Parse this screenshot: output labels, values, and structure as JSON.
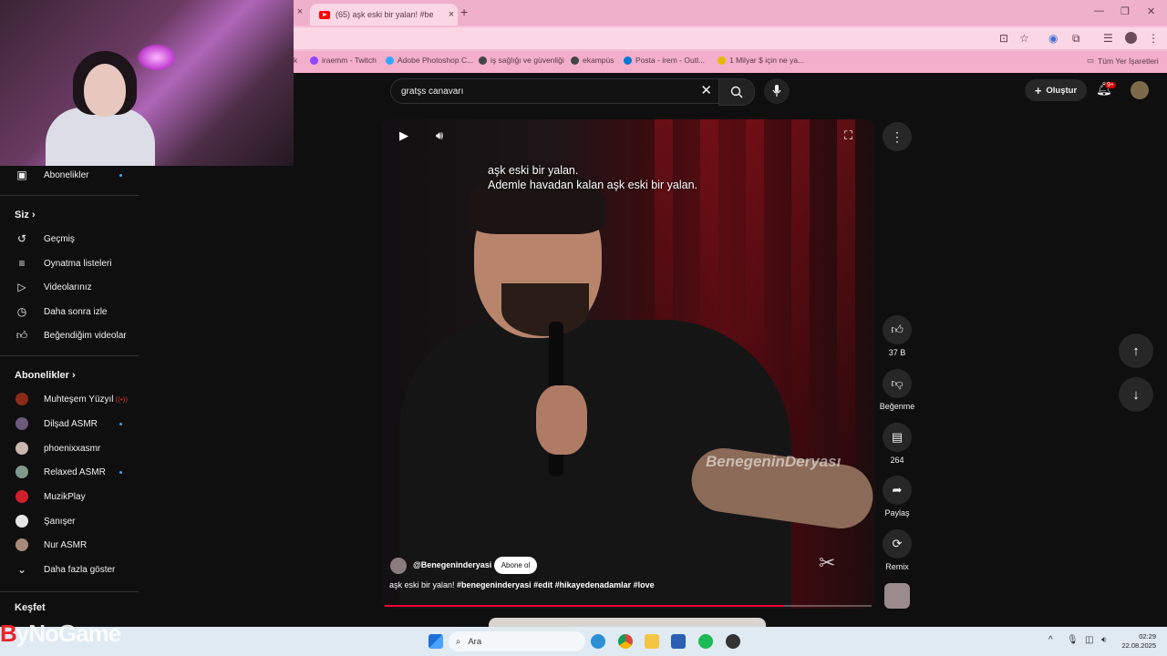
{
  "browser": {
    "tab_title": "(65) aşk eski bir yalan! #be",
    "bookmarks": [
      {
        "label": "iraemm - Twitch",
        "color": "#9146ff"
      },
      {
        "label": "Adobe Photoshop C...",
        "color": "#31a8ff"
      },
      {
        "label": "iş sağlığı ve güvenliği",
        "color": "#444444"
      },
      {
        "label": "ekampüs",
        "color": "#444444"
      },
      {
        "label": "Posta - irem - Outl...",
        "color": "#0078d4"
      },
      {
        "label": "1 Milyar $ için ne ya...",
        "color": "#e6b800"
      }
    ],
    "all_bookmarks": "Tüm Yer İşaretleri"
  },
  "header": {
    "search_value": "gratşs canavarı",
    "create_label": "Oluştur",
    "notif_badge": "9+"
  },
  "sidebar": {
    "top_item": "Abonelikler",
    "you_header": "Siz",
    "you_items": [
      {
        "label": "Geçmiş",
        "icon": "history-icon"
      },
      {
        "label": "Oynatma listeleri",
        "icon": "playlist-icon"
      },
      {
        "label": "Videolarınız",
        "icon": "video-icon"
      },
      {
        "label": "Daha sonra izle",
        "icon": "clock-icon"
      },
      {
        "label": "Beğendiğim videolar",
        "icon": "thumbs-up-icon"
      }
    ],
    "subs_header": "Abonelikler",
    "subs": [
      {
        "label": "Muhteşem Yüzyıl",
        "color": "#8a2a1a",
        "dot": false
      },
      {
        "label": "Dilşad ASMR",
        "color": "#6b5a7a",
        "dot": true
      },
      {
        "label": "phoenixxasmr",
        "color": "#c9b7b0",
        "dot": false
      },
      {
        "label": "Relaxed ASMR",
        "color": "#7f9a8a",
        "dot": true
      },
      {
        "label": "MuzikPlay",
        "color": "#d0202a",
        "dot": false
      },
      {
        "label": "Şanışer",
        "color": "#e6e6e6",
        "dot": false
      },
      {
        "label": "Nur ASMR",
        "color": "#a88a7a",
        "dot": false
      }
    ],
    "show_more": "Daha fazla göster",
    "explore": "Keşfet"
  },
  "video": {
    "subtitle_line1": "aşk eski bir yalan.",
    "subtitle_line2": "Ademle havadan kalan aşk eski bir yalan.",
    "watermark": "BenegeninDeryası",
    "channel": "@Benegeninderyasi",
    "subscribe_label": "Abone ol",
    "title_plain": "aşk eski bir yalan!",
    "title_tags": "#benegeninderyasi #edit #hikayedenadamlar #love",
    "progress": 0.82
  },
  "actions": {
    "like_count": "37 B",
    "dislike_label": "Beğenme",
    "comment_count": "264",
    "share_label": "Paylaş",
    "remix_label": "Remix"
  },
  "taskbar": {
    "search_placeholder": "Ara",
    "time": "02:29",
    "date": "22.08.2025"
  },
  "overlay": {
    "logo_prefix": "B",
    "logo_rest": "yNoGame"
  },
  "colors": {
    "accent": "#ff0033",
    "chrome_pink": "#f5bcd4"
  }
}
